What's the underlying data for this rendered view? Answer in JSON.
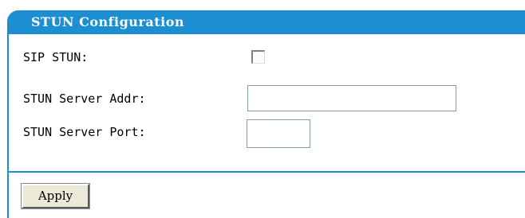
{
  "panel": {
    "title": "STUN Configuration"
  },
  "fields": {
    "sip_stun_label": "SIP STUN:",
    "sip_stun_checked": false,
    "server_addr_label": "STUN Server Addr:",
    "server_addr_value": "",
    "server_port_label": "STUN Server Port:",
    "server_port_value": ""
  },
  "actions": {
    "apply_label": "Apply"
  },
  "colors": {
    "accent": "#1c8fd2",
    "button_face": "#ece9d8"
  }
}
